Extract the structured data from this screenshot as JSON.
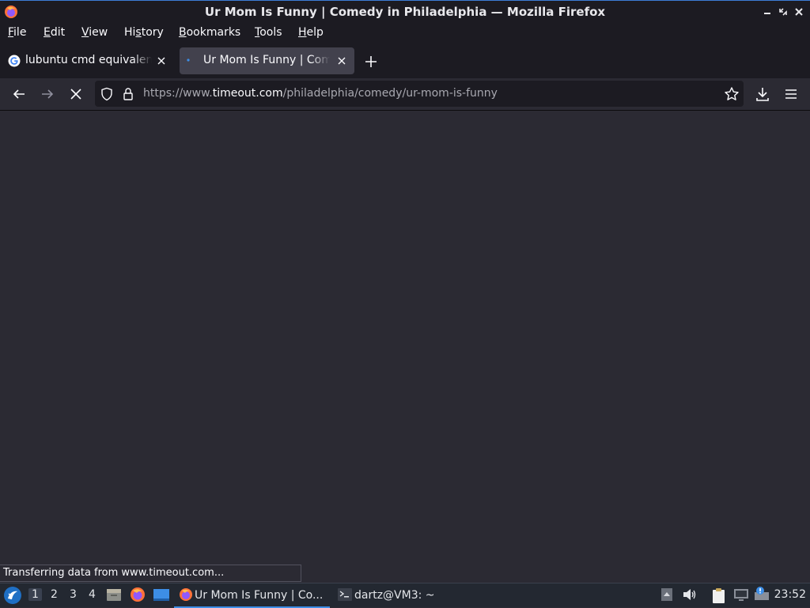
{
  "window": {
    "title": "Ur Mom Is Funny | Comedy in Philadelphia — Mozilla Firefox",
    "controls": [
      "minimize",
      "restore",
      "close"
    ]
  },
  "menubar": {
    "items": [
      {
        "label": "File",
        "mnemonic": "F",
        "rest": "ile"
      },
      {
        "label": "Edit",
        "mnemonic": "E",
        "rest": "dit"
      },
      {
        "label": "View",
        "mnemonic": "V",
        "rest": "iew"
      },
      {
        "label": "History",
        "mnemonic": "",
        "rest": "History"
      },
      {
        "label": "Bookmarks",
        "mnemonic": "B",
        "rest": "ookmarks"
      },
      {
        "label": "Tools",
        "mnemonic": "T",
        "rest": "ools"
      },
      {
        "label": "Help",
        "mnemonic": "H",
        "rest": "elp"
      }
    ]
  },
  "tabs": [
    {
      "label": "lubuntu cmd equivalent",
      "favicon": "google-g-icon",
      "active": false
    },
    {
      "label": "Ur Mom Is Funny | Comedy in Philadelphia",
      "favicon": "loading-dot-icon",
      "active": true
    }
  ],
  "navbar": {
    "url_prefix": "https://www.",
    "url_host": "timeout.com",
    "url_path": "/philadelphia/comedy/ur-mom-is-funny",
    "loading": true
  },
  "status": {
    "text": "Transferring data from www.timeout.com..."
  },
  "taskbar": {
    "desktops": [
      "1",
      "2",
      "3",
      "4"
    ],
    "current_desktop": "1",
    "tasks": [
      {
        "label": "Ur Mom Is Funny | Co...",
        "icon": "firefox-icon",
        "active": true
      },
      {
        "label": "dartz@VM3: ~",
        "icon": "terminal-icon",
        "active": false
      }
    ],
    "clock": "23:52"
  },
  "colors": {
    "chrome_dark": "#1c1b22",
    "content_bg": "#2b2a33",
    "active_tab": "#42414d",
    "accent_blue": "#3d8ee6",
    "taskbar_bg": "#232831"
  }
}
